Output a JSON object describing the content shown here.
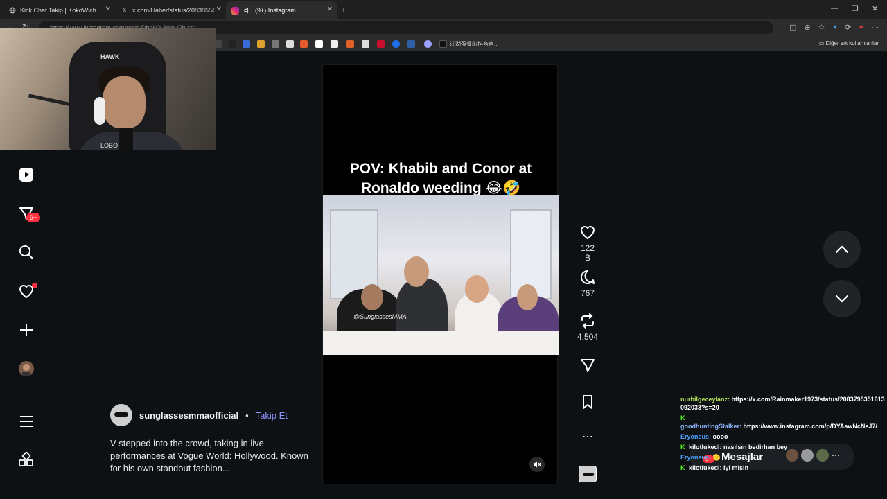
{
  "browser": {
    "tabs": [
      {
        "title": "Kick Chat Takip | KokoWich",
        "active": false
      },
      {
        "title": "x.com/Haber/status/20838554861",
        "active": false
      },
      {
        "title": "(9+) Instagram",
        "active": true
      }
    ],
    "url": "https://www.instagram.com/reels/DbbkQ-8oin-/?hl=tr",
    "bookmark_text": "江湖蛋餐的抖音直...",
    "other_bookmarks": "Diğer sık kullanılanlar"
  },
  "webcam": {
    "chair_logo": "HAWK",
    "shirt_text": "LOBO"
  },
  "sidebar": {
    "items": [
      {
        "icon": "reels-icon"
      },
      {
        "icon": "direct-messages-icon",
        "badge": "9+"
      },
      {
        "icon": "search-icon"
      },
      {
        "icon": "notifications-heart-icon"
      },
      {
        "icon": "create-plus-icon"
      },
      {
        "icon": "profile-avatar-icon"
      },
      {
        "icon": "menu-hamburger-icon"
      },
      {
        "icon": "apps-grid-icon"
      }
    ]
  },
  "post": {
    "author": "sunglassesmmaofficial",
    "separator": "•",
    "follow_label": "Takip Et",
    "caption": "V stepped into the crowd, taking in live performances at Vogue World: Hollywood. Known for his own standout fashion..."
  },
  "reel": {
    "title_line1": "POV: Khabib and Conor at",
    "title_line2": "Ronaldo weeding 😂🤣",
    "watermark": "@SunglassesMMA"
  },
  "actions": {
    "likes": "122 B",
    "comments": "767",
    "reposts": "4.504"
  },
  "chat": {
    "messages": [
      {
        "user": "nurbilgeceylanz:",
        "text": "https://x.com/Rainmaker1973/status/2083795351613092033?s=20",
        "color": "#b6e35a",
        "kick": false
      },
      {
        "user": "goodhuntingStalker:",
        "text": "https://www.instagram.com/p/DYAawNcNeJ7/",
        "color": "#8ab4f8",
        "kick": true
      },
      {
        "user": "Eryoneus:",
        "text": "oooo",
        "color": "#4aa3ff",
        "kick": false
      },
      {
        "user": "kilotlukedi:",
        "text": "nasılsın bedirhan bey",
        "color": "#ffffff",
        "kick": true
      },
      {
        "user": "Eryoneus:",
        "text": "🫡",
        "color": "#4aa3ff",
        "kick": false
      },
      {
        "user": "kilotlukedi:",
        "text": "iyi misin",
        "color": "#ffffff",
        "kick": true
      }
    ],
    "kick_symbol": "K"
  },
  "messages_pill": {
    "label": "Mesajlar",
    "badge": "9+"
  }
}
